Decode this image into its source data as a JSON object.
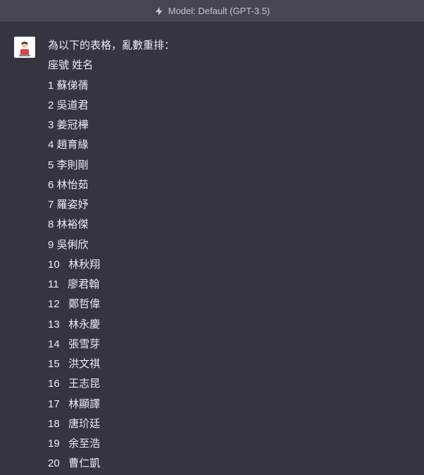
{
  "model_bar": {
    "label": "Model: Default (GPT-3.5)"
  },
  "message": {
    "prompt": "為以下的表格，亂數重排：",
    "header_seat": "座號",
    "header_name": "姓名",
    "rows": [
      {
        "seat": "1",
        "name": "蘇俤蒨"
      },
      {
        "seat": "2",
        "name": "吳道君"
      },
      {
        "seat": "3",
        "name": "姜冠樺"
      },
      {
        "seat": "4",
        "name": "趙育緣"
      },
      {
        "seat": "5",
        "name": "李則剛"
      },
      {
        "seat": "6",
        "name": "林怡茹"
      },
      {
        "seat": "7",
        "name": "羅姿妤"
      },
      {
        "seat": "8",
        "name": "林裕傑"
      },
      {
        "seat": "9",
        "name": "吳俐欣"
      },
      {
        "seat": "10",
        "name": "林秋翔"
      },
      {
        "seat": "11",
        "name": "廖君翰"
      },
      {
        "seat": "12",
        "name": "鄭哲偉"
      },
      {
        "seat": "13",
        "name": "林永慶"
      },
      {
        "seat": "14",
        "name": "張雪芽"
      },
      {
        "seat": "15",
        "name": "洪文祺"
      },
      {
        "seat": "16",
        "name": "王志昆"
      },
      {
        "seat": "17",
        "name": "林顯譯"
      },
      {
        "seat": "18",
        "name": "唐玠廷"
      },
      {
        "seat": "19",
        "name": "余至浩"
      },
      {
        "seat": "20",
        "name": "曹仁凱"
      }
    ]
  }
}
